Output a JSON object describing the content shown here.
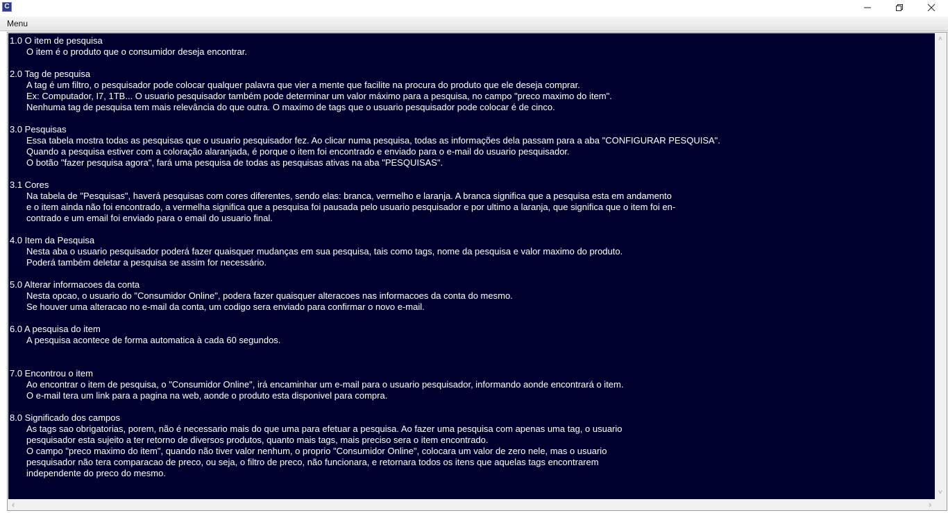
{
  "window": {
    "app_icon_glyph": "C",
    "minimize_icon": "minimize-icon",
    "maximize_icon": "restore-icon",
    "close_icon": "close-icon"
  },
  "menubar": {
    "menu_label": "Menu"
  },
  "sections": [
    {
      "title": "1.0 O item de pesquisa",
      "lines": [
        "O item é o produto que o consumidor deseja encontrar."
      ],
      "gap_after": 1
    },
    {
      "title": "2.0 Tag de pesquisa",
      "lines": [
        "A tag é um filtro, o pesquisador pode colocar qualquer palavra que vier a mente que facilite na procura do produto que ele deseja comprar.",
        "Ex: Computador, I7, 1TB... O usuario pesquisador também pode determinar um valor máximo para a pesquisa, no campo \"preco maximo do item\".",
        "Nenhuma tag de pesquisa tem mais  relevância do que outra. O maximo de tags que o usuario pesquisador pode colocar é de cinco."
      ],
      "gap_after": 1
    },
    {
      "title": "3.0 Pesquisas",
      "lines": [
        "Essa tabela mostra todas as pesquisas que o usuario pesquisador fez. Ao clicar numa pesquisa, todas as informações dela passam para a aba \"CONFIGURAR PESQUISA\".",
        "Quando a pesquisa estiver com a coloração alaranjada, é porque o item foi encontrado e enviado para o e-mail do usuario pesquisador.",
        "O botão \"fazer pesquisa  agora\", fará uma pesquisa de todas as pesquisas ativas na aba \"PESQUISAS\"."
      ],
      "gap_after": 1
    },
    {
      "title": "3.1 Cores",
      "lines": [
        "Na tabela de \"Pesquisas\", haverá pesquisas com cores diferentes, sendo elas: branca, vermelho e laranja. A branca significa que a pesquisa esta em andamento",
        "e o item ainda não foi encontrado, a vermelha significa que a pesquisa foi pausada pelo usuario pesquisador e por ultimo a laranja, que significa que o item foi en-",
        "contrado e um email foi enviado para o email do usuario final."
      ],
      "gap_after": 1
    },
    {
      "title": "4.0 Item da Pesquisa",
      "lines": [
        "Nesta aba o usuario pesquisador poderá fazer quaisquer mudanças em sua pesquisa, tais como tags, nome da pesquisa e valor maximo do produto.",
        "Poderá também deletar a pesquisa se assim for necessário."
      ],
      "gap_after": 1
    },
    {
      "title": "5.0 Alterar informacoes da conta",
      "lines": [
        "Nesta opcao, o usuario do \"Consumidor Online\", podera fazer quaisquer alteracoes nas informacoes da conta do mesmo.",
        "Se houver uma alteracao no e-mail da conta, um codigo sera enviado para confirmar o novo e-mail."
      ],
      "gap_after": 1
    },
    {
      "title": "6.0 A pesquisa do item",
      "lines": [
        "A pesquisa acontece de forma automatica à cada 60 segundos."
      ],
      "gap_after": 2
    },
    {
      "title": "7.0 Encontrou o item",
      "lines": [
        "Ao encontrar o item de pesquisa, o \"Consumidor Online\", irá encaminhar um e-mail para o usuario pesquisador, informando aonde encontrará o item.",
        "O e-mail tera um link para a pagina na web, aonde o produto esta disponivel para compra."
      ],
      "gap_after": 1
    },
    {
      "title": "8.0 Significado dos campos",
      "lines": [
        "As tags sao obrigatorias, porem, não é necessario mais do que uma para efetuar a pesquisa. Ao fazer uma pesquisa com apenas uma tag, o usuario",
        "pesquisador esta sujeito a ter retorno de diversos produtos, quanto mais tags, mais preciso sera o item encontrado.",
        "O campo \"preco maximo do item\", quando não tiver valor nenhum, o proprio \"Consumidor Online\", colocara um valor de zero nele, mas o usuario",
        "pesquisador não tera comparacao de preco, ou seja, o filtro de preco, não funcionara, e retornara todos os itens que aquelas tags encontrarem",
        "independente do preco do mesmo."
      ],
      "gap_after": 0
    }
  ],
  "scrollbars": {
    "left_arrow": "‹",
    "right_arrow": "›",
    "up_arrow": "˄",
    "down_arrow": "˅"
  }
}
